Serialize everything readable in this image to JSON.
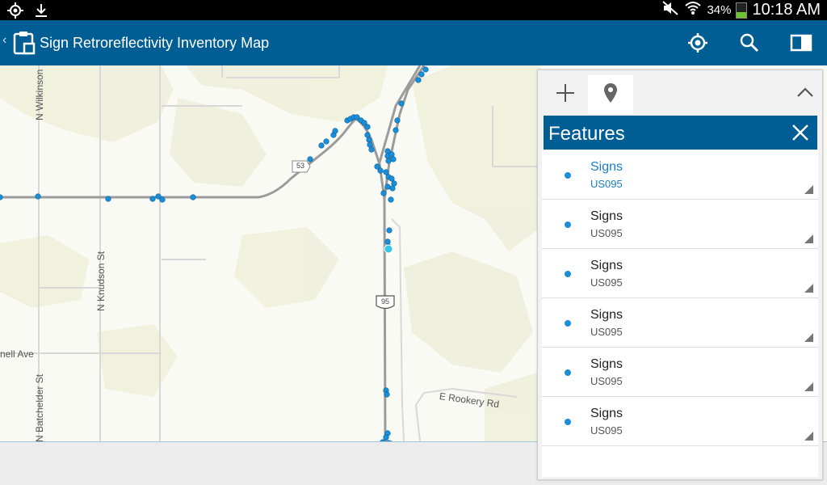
{
  "status_bar": {
    "battery_percent_label": "34%",
    "battery_level": 0.34,
    "time": "10:18 AM",
    "left_icons": [
      "gps-icon",
      "download-icon"
    ],
    "right_icons": [
      "mute-icon",
      "wifi-icon",
      "battery-icon"
    ]
  },
  "app_bar": {
    "title": "Sign Retroreflectivity Inventory Map",
    "actions": [
      "locate-icon",
      "search-icon",
      "panel-toggle-icon"
    ],
    "color": "#005e95"
  },
  "map": {
    "street_labels": {
      "wilkinson": "N Wilkinson",
      "knudson": "N Knudson St",
      "batchelder": "N Batchelder St",
      "nell_ave": "nell Ave",
      "rookery": "E Rookery Rd"
    },
    "route_shields": {
      "state_route": "53",
      "us_route": "95"
    },
    "point_color": "#1a8fd9"
  },
  "panel": {
    "toolbar": {
      "add_icon": "plus-icon",
      "marker_icon": "map-marker-icon",
      "collapse_icon": "chevron-up-icon"
    },
    "title": "Features",
    "close_icon": "close-icon",
    "items": [
      {
        "name": "Signs",
        "sub": "US095",
        "selected": true
      },
      {
        "name": "Signs",
        "sub": "US095",
        "selected": false
      },
      {
        "name": "Signs",
        "sub": "US095",
        "selected": false
      },
      {
        "name": "Signs",
        "sub": "US095",
        "selected": false
      },
      {
        "name": "Signs",
        "sub": "US095",
        "selected": false
      },
      {
        "name": "Signs",
        "sub": "US095",
        "selected": false
      }
    ],
    "selected_color": "#1a7ec4"
  }
}
